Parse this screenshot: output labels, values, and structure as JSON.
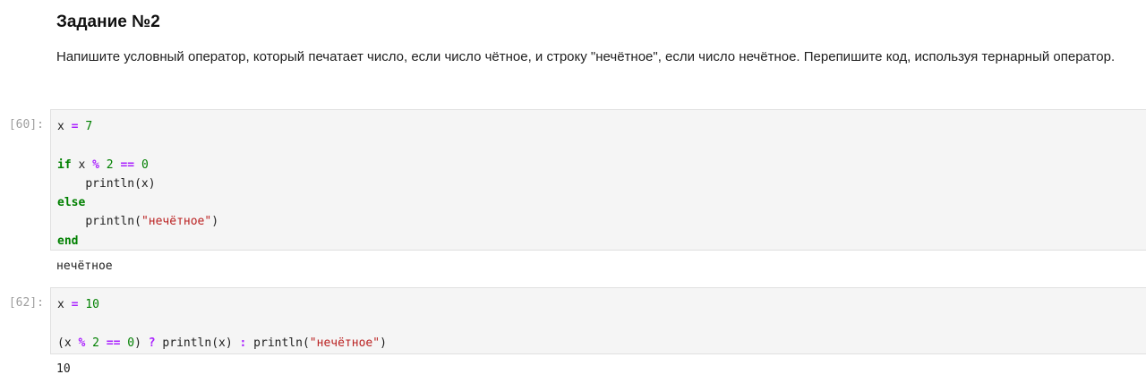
{
  "markdown": {
    "title": "Задание №2",
    "text": "Напишите условный оператор, который печатает число, если число чётное, и строку \"нечётное\", если число нечётное. Перепишите код, используя тернарный оператор."
  },
  "cells": [
    {
      "prompt": "[60]:",
      "code": {
        "l1_var": "x",
        "l1_op": "=",
        "l1_num": "7",
        "l3_if": "if",
        "l3_var": "x",
        "l3_op1": "%",
        "l3_num1": "2",
        "l3_op2": "==",
        "l3_num2": "0",
        "l4_indent": "    ",
        "l4_call": "println(x)",
        "l5_else": "else",
        "l6_indent": "    ",
        "l6_call_open": "println(",
        "l6_str": "\"нечётное\"",
        "l6_close": ")",
        "l7_end": "end"
      },
      "output": "нечётное"
    },
    {
      "prompt": "[62]:",
      "code": {
        "l1_var": "x",
        "l1_op": "=",
        "l1_num": "10",
        "l3_open": "(x ",
        "l3_op1": "%",
        "l3_num1": "2",
        "l3_op2": "==",
        "l3_num2": "0",
        "l3_close": ") ",
        "l3_q": "?",
        "l3_call1": " println(x) ",
        "l3_colon": ":",
        "l3_call2_open": " println(",
        "l3_str": "\"нечётное\"",
        "l3_close2": ")"
      },
      "output": "10"
    }
  ],
  "colors": {
    "keyword": "#008000",
    "operator": "#aa22ff",
    "number": "#008000",
    "string": "#ba2121",
    "cell_background": "#f5f5f5",
    "prompt": "#9e9e9e"
  }
}
